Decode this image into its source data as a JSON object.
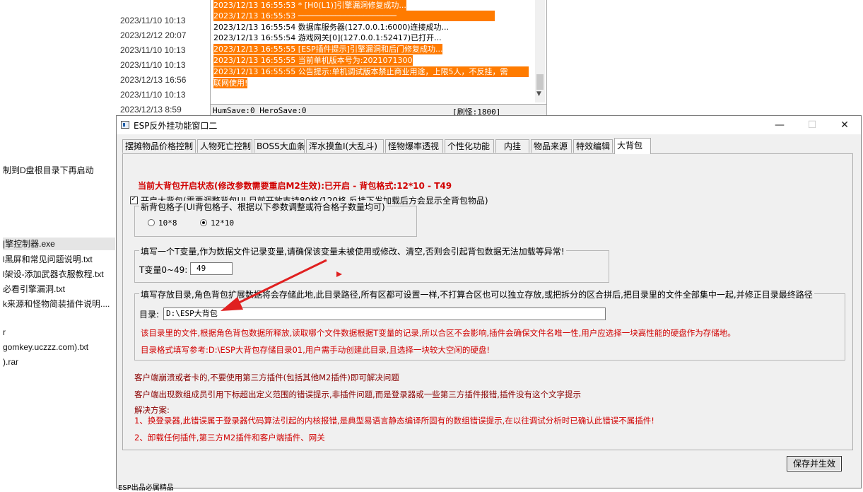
{
  "background": {
    "dates": [
      "2023/11/10 10:13",
      "2023/12/12 20:07",
      "2023/11/10 10:13",
      "2023/11/10 10:13",
      "2023/12/13 16:56",
      "2023/11/10 10:13",
      "2023/12/13 8:59"
    ],
    "left_files": [
      "制到D盘根目录下再启动",
      "|擎控制器.exe",
      "l黑屏和常见问题说明.txt",
      "l架设-添加武器衣服教程.txt",
      "必看引擎漏洞.txt",
      "k来源和怪物简装插件说明....",
      "r",
      "gomkey.uczzz.com).txt",
      ").rar"
    ],
    "log_lines": [
      {
        "text": "2023/12/13 16:55:53 * [H0(L1)]引擎漏洞修复成功...",
        "hl": true
      },
      {
        "text": "2023/12/13 16:55:53 ─────────────────────",
        "hl": true
      },
      {
        "text": "2023/12/13 16:55:54 数据库服务器(127.0.0.1:6000)连接成功...",
        "hl": false
      },
      {
        "text": "2023/12/13 16:55:54 游戏网关[0](127.0.0.1:52417)已打开...",
        "hl": false
      },
      {
        "text": "2023/12/13 16:55:55 [ESP插件提示]引擎漏洞和后门修复成功...",
        "hl": true
      },
      {
        "text": "2023/12/13 16:55:55 当前单机版本号为:2021071300",
        "hl": true
      },
      {
        "text": "2023/12/13 16:55:55 公告提示:单机调试版本禁止商业用途，上限5人，不反挂，需",
        "hl": true
      },
      {
        "text": "联网使用!",
        "hl": true
      }
    ],
    "log_status_left": "HumSave:0 HeroSave:0",
    "log_status_right": "[刷怪:1800]"
  },
  "window": {
    "title": "ESP反外挂功能窗口二",
    "minimize": "—",
    "maximize": "☐",
    "close": "✕",
    "tabs": [
      "摆摊物品价格控制",
      "人物死亡控制",
      "BOSS大血条",
      "浑水摸鱼I(大乱斗)",
      "怪物爆率透视",
      "个性化功能",
      "内挂",
      "物品来源",
      "特效编辑",
      "大背包"
    ],
    "active_tab": "大背包",
    "checkbox_label": "开启大背包(需要调整背包UI,目前开放支持80格/120格,反挂下发加载后方会显示全背包物品)",
    "status_line": "当前大背包开启状态(修改参数需要重启M2生效):已开启 - 背包格式:12*10 - T49",
    "grid_group": {
      "legend": "新背包格子(UI背包格子、根据以下参数调整或符合格子数量均可)",
      "options": [
        "10*8",
        "12*10"
      ],
      "selected": "12*10"
    },
    "tvar_group": {
      "legend": "填写一个T变量,作为数据文件记录变量,请确保该变量未被使用或修改、清空,否则会引起背包数据无法加载等异常!",
      "label": "T变量0~49:",
      "value": "49"
    },
    "dir_group": {
      "legend": "填写存放目录,角色背包扩展数据将会存储此地,此目录路径,所有区都可设置一样,不打算合区也可以独立存放,或把拆分的区合拼后,把目录里的文件全部集中一起,并修正目录最终路径",
      "label": "目录:",
      "value": "D:\\ESP大背包",
      "note1": "该目录里的文件,根据角色背包数据所释放,读取哪个文件数据根据T变量的记录,所以合区不会影响,插件会确保文件名唯一性,用户应选择一块高性能的硬盘作为存储地。",
      "note2": "目录格式填写参考:D:\\ESP大背包存储目录01,用户需手动创建此目录,且选择一块较大空闲的硬盘!"
    },
    "info": [
      "客户端崩溃或者卡的,不要使用第三方插件(包括其他M2插件)即可解决问题",
      "客户端出现数组成员引用下标超出定义范围的错误提示,非插件问题,而是登录器或一些第三方插件报错,插件没有这个文字提示",
      "解决方案:",
      "1、换登录器,此错误属于登录器代码算法引起的内核报错,是典型易语言静态编译所固有的数组错误提示,在以往调试分析时已确认此错误不属插件!",
      "2、卸载任何插件,第三方M2插件和客户端插件、网关"
    ],
    "save_button": "保存并生效",
    "statusbar_text": "ESP出品必属精品"
  },
  "colors": {
    "highlight": "#ff7b00",
    "red": "#d10000",
    "arrow": "#e02020"
  }
}
